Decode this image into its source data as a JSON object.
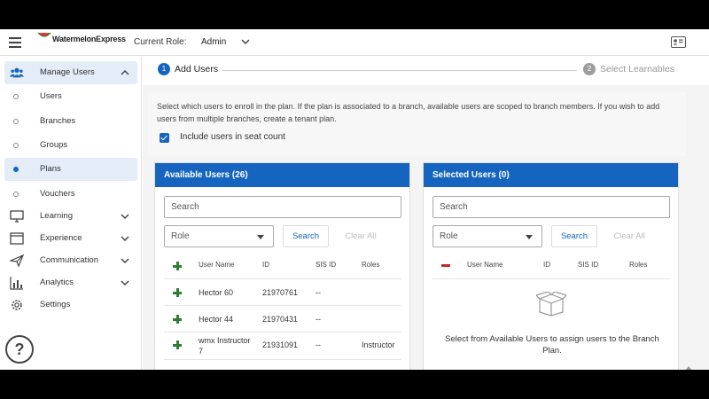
{
  "header": {
    "logo_text": "WatermelonExpress",
    "role_label": "Current Role:",
    "role_value": "Admin"
  },
  "sidebar": {
    "items": [
      {
        "label": "Manage Users",
        "icon": "users-icon",
        "active_section": true
      },
      {
        "label": "Users",
        "icon": "dot"
      },
      {
        "label": "Branches",
        "icon": "dot"
      },
      {
        "label": "Groups",
        "icon": "dot"
      },
      {
        "label": "Plans",
        "icon": "dot",
        "selected": true
      },
      {
        "label": "Vouchers",
        "icon": "dot"
      },
      {
        "label": "Learning",
        "icon": "monitor-icon"
      },
      {
        "label": "Experience",
        "icon": "window-icon"
      },
      {
        "label": "Communication",
        "icon": "paper-plane-icon"
      },
      {
        "label": "Analytics",
        "icon": "bar-chart-icon"
      },
      {
        "label": "Settings",
        "icon": "gear-icon"
      }
    ],
    "help": "?"
  },
  "stepper": {
    "step1_num": "1",
    "step1_label": "Add Users",
    "step2_num": "2",
    "step2_label": "Select Learnables"
  },
  "description": {
    "text": "Select which users to enroll in the plan. If the plan is associated to a branch, available users are scoped to branch members. If you wish to add users from multiple branches, create a tenant plan.",
    "checkbox_label": "Include users in seat count",
    "checkbox_checked": true
  },
  "available": {
    "title": "Available Users (26)",
    "search_placeholder": "Search",
    "role_placeholder": "Role",
    "search_btn": "Search",
    "clear_btn": "Clear All",
    "columns": [
      "User Name",
      "ID",
      "SIS ID",
      "Roles"
    ],
    "rows": [
      {
        "name": "Hector 60",
        "id": "21970761",
        "sis": "--",
        "roles": ""
      },
      {
        "name": "Hector 44",
        "id": "21970431",
        "sis": "--",
        "roles": ""
      },
      {
        "name": "wmx Instructor 7",
        "id": "21931091",
        "sis": "--",
        "roles": "Instructor"
      }
    ]
  },
  "selected": {
    "title": "Selected Users (0)",
    "search_placeholder": "Search",
    "role_placeholder": "Role",
    "search_btn": "Search",
    "clear_btn": "Clear All",
    "columns": [
      "User Name",
      "ID",
      "SIS ID",
      "Roles"
    ],
    "empty_text": "Select from Available Users to assign users to the Branch Plan."
  },
  "colors": {
    "primary": "#1565c0",
    "add_green": "#2e7d32",
    "remove_red": "#c62828",
    "active_bg": "#e3ecf7"
  }
}
